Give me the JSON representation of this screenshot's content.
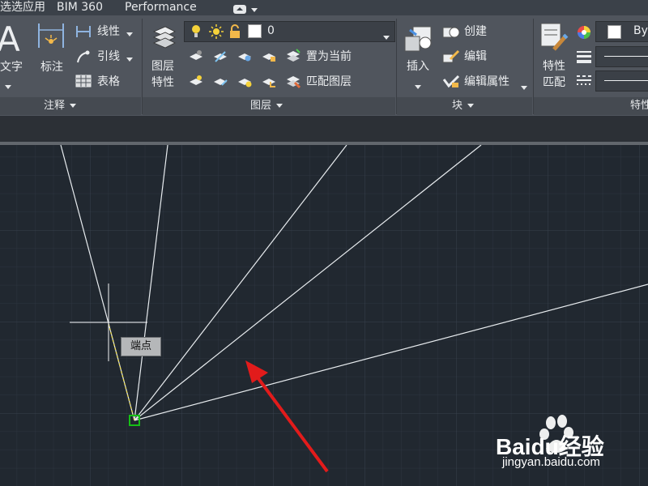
{
  "tabs": {
    "addins": "选选应用",
    "bim": "BIM 360",
    "performance": "Performance"
  },
  "annotation": {
    "text_label": "文字",
    "dimension_label": "标注",
    "linear_label": "线性",
    "leader_label": "引线",
    "table_label": "表格",
    "panel_title": "注释"
  },
  "layers": {
    "properties_line1": "图层",
    "properties_line2": "特性",
    "current_layer": "0",
    "make_current": "置为当前",
    "match_layer": "匹配图层",
    "panel_title": "图层"
  },
  "block": {
    "insert_label": "插入",
    "create_label": "创建",
    "edit_label": "编辑",
    "edit_attributes_label": "编辑属性",
    "panel_title": "块"
  },
  "properties": {
    "match_line1": "特性",
    "match_line2": "匹配",
    "color_value": "By",
    "panel_title": "特性"
  },
  "canvas": {
    "osnap_tooltip": "端点"
  },
  "watermark": {
    "logo": "Baidu经验",
    "url": "jingyan.baidu.com"
  },
  "colors": {
    "ribbon_bg": "#50555d",
    "canvas_bg": "#212830",
    "line_color": "#e8ecef",
    "snap_marker": "#16c016",
    "arrow_red": "#e21b1b"
  }
}
